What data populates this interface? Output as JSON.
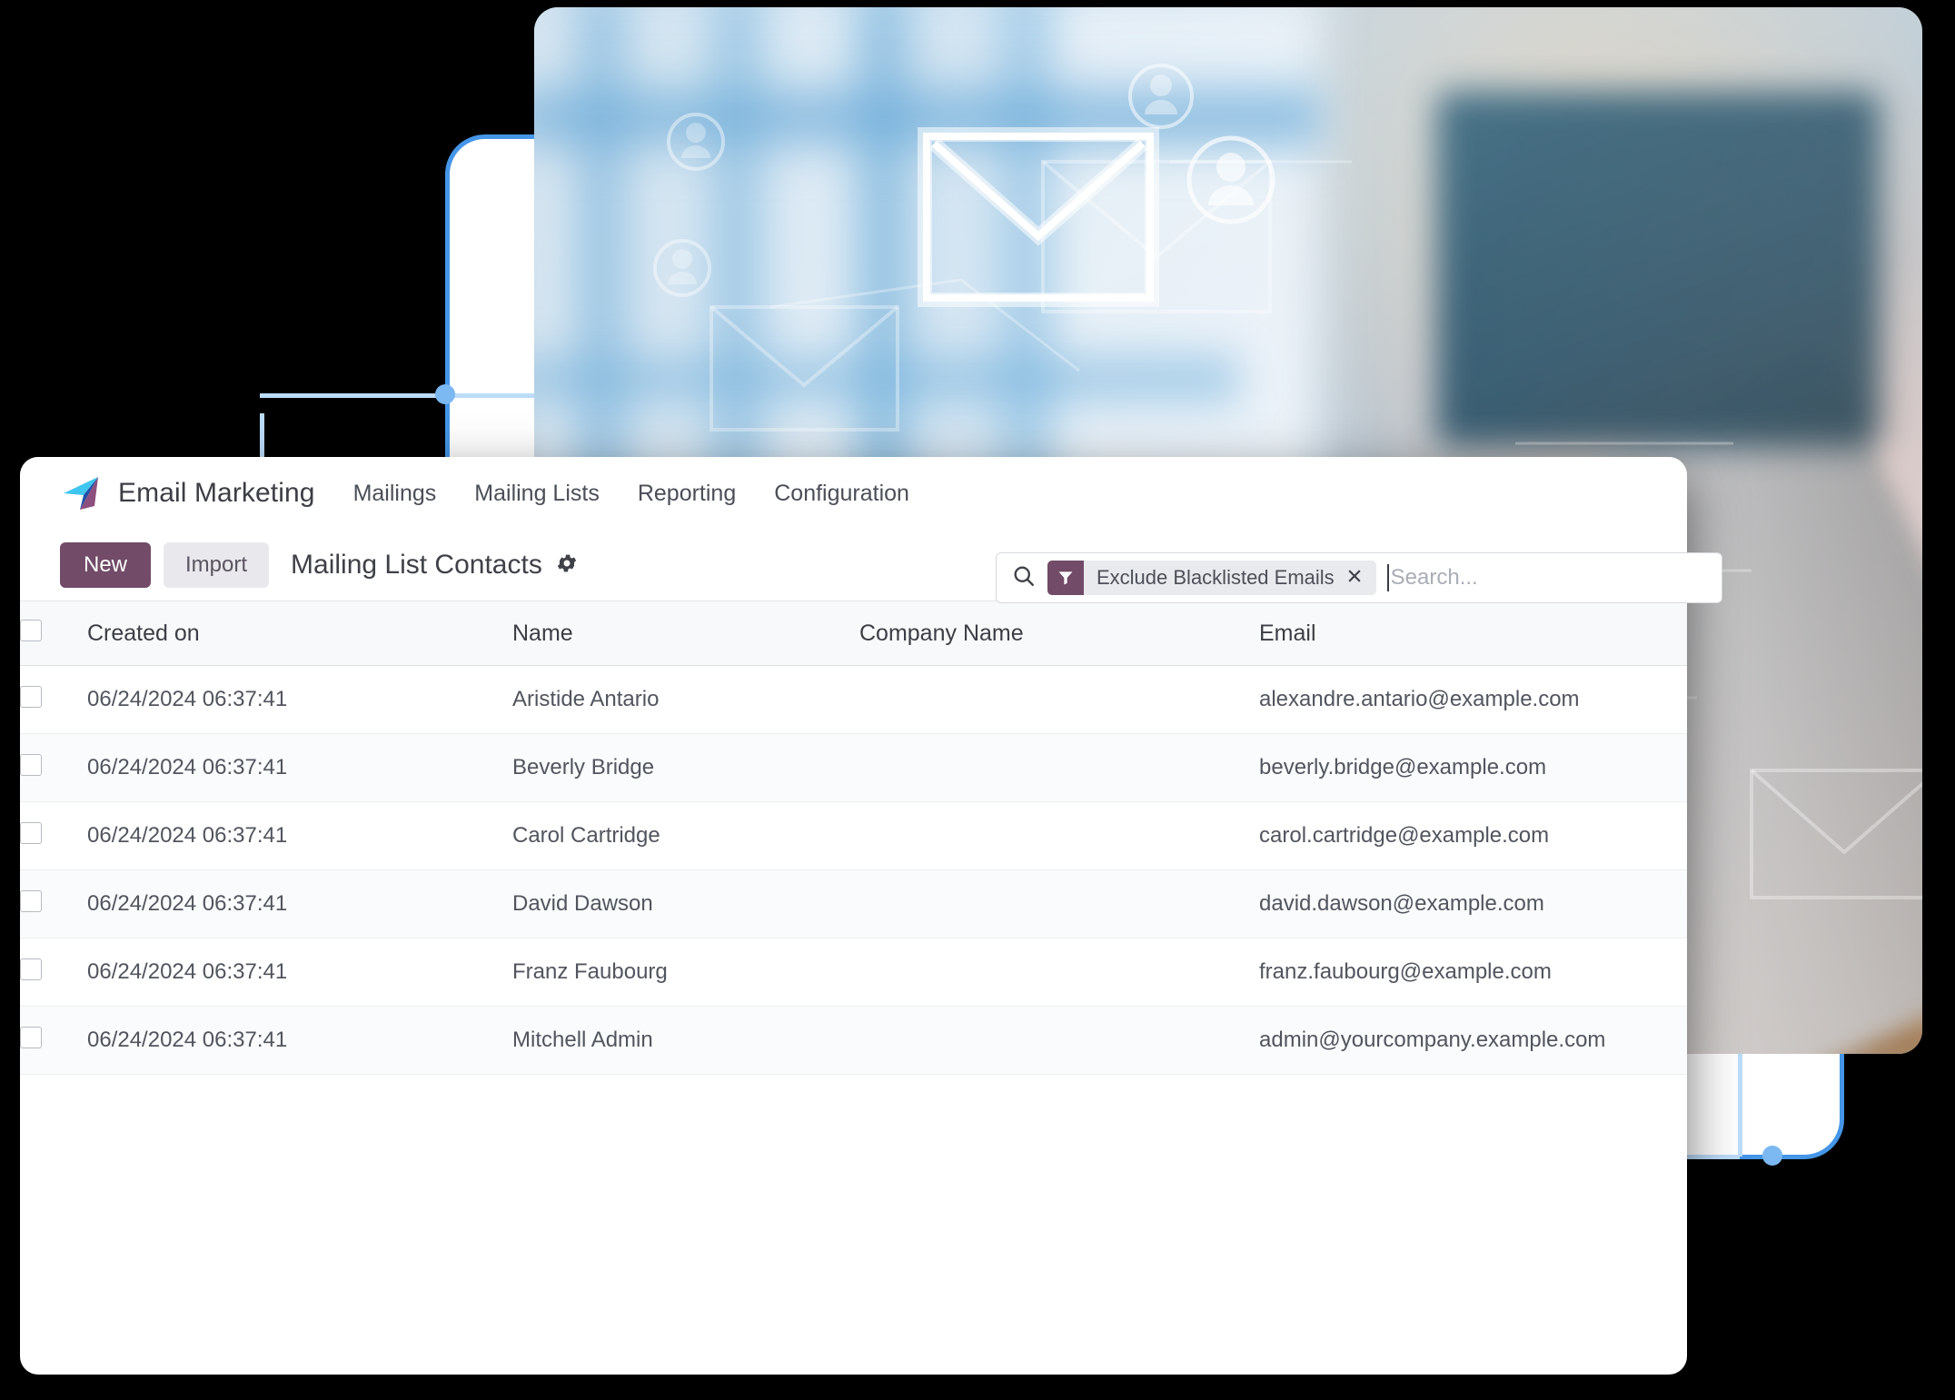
{
  "app": {
    "brand_name": "Email Marketing",
    "logo_icon": "paper-plane-icon",
    "nav_items": [
      {
        "label": "Mailings"
      },
      {
        "label": "Mailing Lists"
      },
      {
        "label": "Reporting"
      },
      {
        "label": "Configuration"
      }
    ]
  },
  "controls": {
    "new_label": "New",
    "import_label": "Import",
    "page_title": "Mailing List Contacts",
    "gear_icon": "gear-icon"
  },
  "search": {
    "search_icon": "search-icon",
    "facet_icon": "filter-funnel-icon",
    "facet_label": "Exclude Blacklisted Emails",
    "facet_remove_icon": "close-x-icon",
    "placeholder": "Search..."
  },
  "table": {
    "columns": [
      {
        "key": "created_on",
        "label": "Created on"
      },
      {
        "key": "name",
        "label": "Name"
      },
      {
        "key": "company_name",
        "label": "Company Name"
      },
      {
        "key": "email",
        "label": "Email"
      }
    ],
    "rows": [
      {
        "created_on": "06/24/2024 06:37:41",
        "name": "Aristide Antario",
        "company_name": "",
        "email": "alexandre.antario@example.com"
      },
      {
        "created_on": "06/24/2024 06:37:41",
        "name": "Beverly Bridge",
        "company_name": "",
        "email": "beverly.bridge@example.com"
      },
      {
        "created_on": "06/24/2024 06:37:41",
        "name": "Carol Cartridge",
        "company_name": "",
        "email": "carol.cartridge@example.com"
      },
      {
        "created_on": "06/24/2024 06:37:41",
        "name": "David Dawson",
        "company_name": "",
        "email": "david.dawson@example.com"
      },
      {
        "created_on": "06/24/2024 06:37:41",
        "name": "Franz Faubourg",
        "company_name": "",
        "email": "franz.faubourg@example.com"
      },
      {
        "created_on": "06/24/2024 06:37:41",
        "name": "Mitchell Admin",
        "company_name": "",
        "email": "admin@yourcompany.example.com"
      }
    ]
  },
  "decor": {
    "hero_photo_alt": "blurred office desk with glowing envelope and contact icons",
    "wireframe_panel": "rounded-outline-panel"
  },
  "colors": {
    "brand_purple": "#714b67",
    "accent_blue": "#4596e8",
    "guide_blue": "#bcdcfb",
    "page_background": "#000000",
    "card_background": "#ffffff",
    "table_header_background": "#f8f9fa",
    "text_primary": "#3b3e45",
    "text_secondary": "#51555e",
    "placeholder_text": "#a9adb6"
  }
}
